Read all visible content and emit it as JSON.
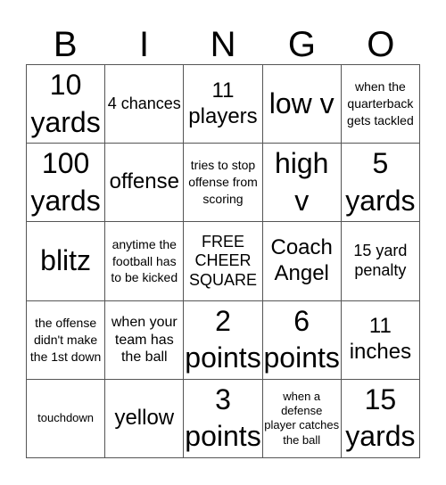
{
  "header": {
    "letters": [
      "B",
      "I",
      "N",
      "G",
      "O"
    ]
  },
  "cells": [
    [
      "10 yards",
      "4 chances",
      "11 players",
      "low v",
      "when the quarterback gets tackled"
    ],
    [
      "100 yards",
      "offense",
      "tries to stop offense from scoring",
      "high v",
      "5 yards"
    ],
    [
      "blitz",
      "anytime the football has to be kicked",
      "FREE CHEER SQUARE",
      "Coach Angel",
      "15 yard penalty"
    ],
    [
      "the offense didn't make the 1st down",
      "when your team has the ball",
      "2 points",
      "6 points",
      "11 inches"
    ],
    [
      "touchdown",
      "yellow",
      "3 points",
      "when a defense player catches the ball",
      "15 yards"
    ]
  ]
}
